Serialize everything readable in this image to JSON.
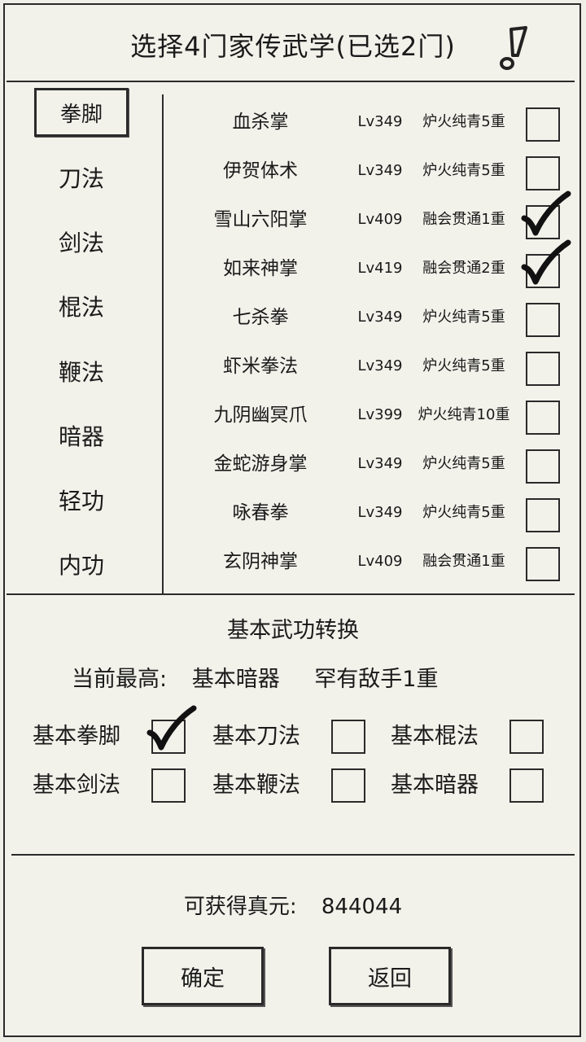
{
  "title": "选择4门家传武学(已选2门)",
  "icons": {
    "alert": "exclamation-icon",
    "check": "checkmark-icon"
  },
  "categories": [
    {
      "label": "拳脚",
      "selected": true
    },
    {
      "label": "刀法",
      "selected": false
    },
    {
      "label": "剑法",
      "selected": false
    },
    {
      "label": "棍法",
      "selected": false
    },
    {
      "label": "鞭法",
      "selected": false
    },
    {
      "label": "暗器",
      "selected": false
    },
    {
      "label": "轻功",
      "selected": false
    },
    {
      "label": "内功",
      "selected": false
    }
  ],
  "skills": [
    {
      "name": "血杀掌",
      "level": "Lv349",
      "rank": "炉火纯青5重",
      "checked": false
    },
    {
      "name": "伊贺体术",
      "level": "Lv349",
      "rank": "炉火纯青5重",
      "checked": false
    },
    {
      "name": "雪山六阳掌",
      "level": "Lv409",
      "rank": "融会贯通1重",
      "checked": true
    },
    {
      "name": "如来神掌",
      "level": "Lv419",
      "rank": "融会贯通2重",
      "checked": true
    },
    {
      "name": "七杀拳",
      "level": "Lv349",
      "rank": "炉火纯青5重",
      "checked": false
    },
    {
      "name": "虾米拳法",
      "level": "Lv349",
      "rank": "炉火纯青5重",
      "checked": false
    },
    {
      "name": "九阴幽冥爪",
      "level": "Lv399",
      "rank": "炉火纯青10重",
      "checked": false
    },
    {
      "name": "金蛇游身掌",
      "level": "Lv349",
      "rank": "炉火纯青5重",
      "checked": false
    },
    {
      "name": "咏春拳",
      "level": "Lv349",
      "rank": "炉火纯青5重",
      "checked": false
    },
    {
      "name": "玄阴神掌",
      "level": "Lv409",
      "rank": "融会贯通1重",
      "checked": false
    }
  ],
  "conversion": {
    "title": "基本武功转换",
    "current_label": "当前最高:",
    "current_skill": "基本暗器",
    "current_rank": "罕有敌手1重",
    "options": [
      {
        "label": "基本拳脚",
        "checked": true
      },
      {
        "label": "基本刀法",
        "checked": false
      },
      {
        "label": "基本棍法",
        "checked": false
      },
      {
        "label": "基本剑法",
        "checked": false
      },
      {
        "label": "基本鞭法",
        "checked": false
      },
      {
        "label": "基本暗器",
        "checked": false
      }
    ]
  },
  "gain": {
    "label": "可获得真元:",
    "value": "844044"
  },
  "buttons": {
    "confirm": "确定",
    "back": "返回"
  }
}
